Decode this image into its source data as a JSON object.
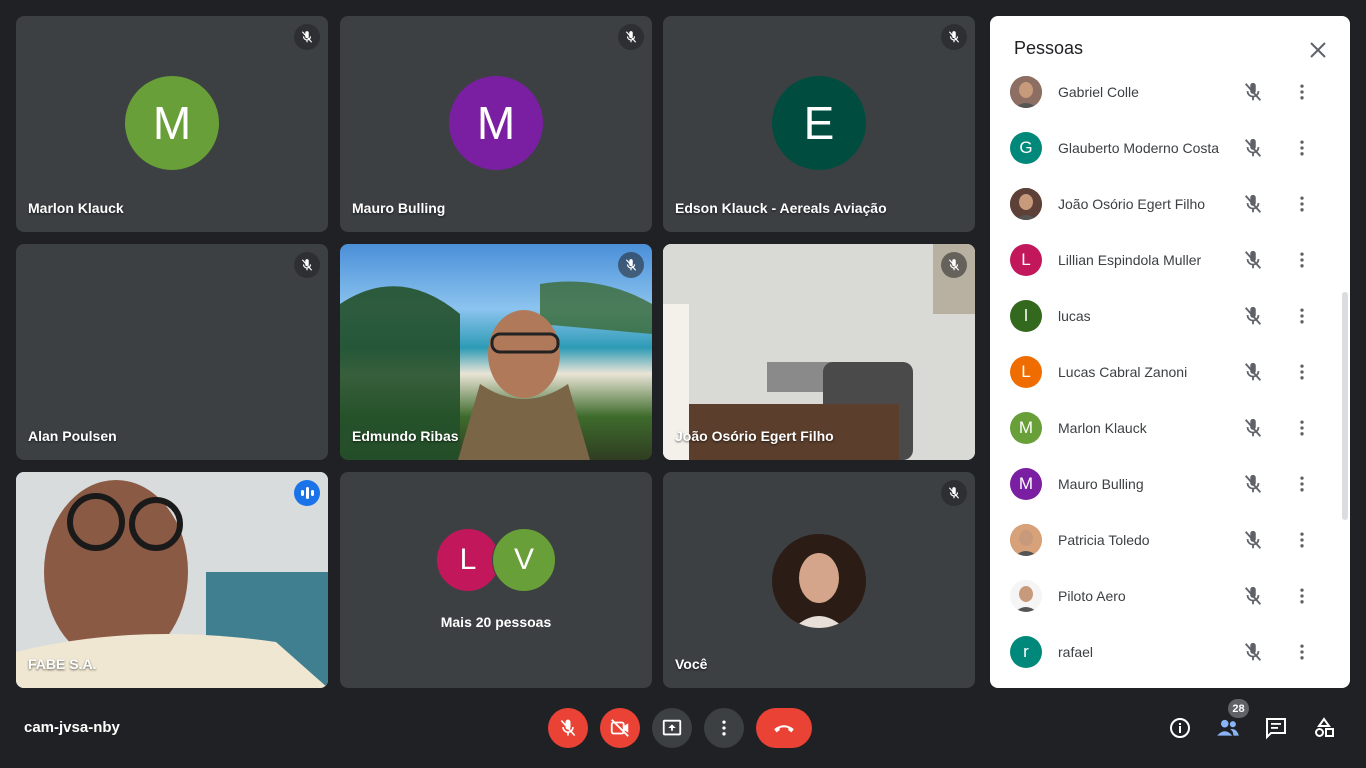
{
  "tiles": [
    {
      "name": "Marlon Klauck",
      "initial": "M",
      "color": "#689f38"
    },
    {
      "name": "Mauro Bulling",
      "initial": "M",
      "color": "#7b1fa2"
    },
    {
      "name": "Edson Klauck - Aereals Aviação",
      "initial": "E",
      "color": "#004d40"
    },
    {
      "name": "Alan Poulsen"
    },
    {
      "name": "Edmundo Ribas"
    },
    {
      "name": "João Osório Egert Filho"
    },
    {
      "name": "FABE S.A."
    },
    {
      "label": "Mais 20 pessoas",
      "avatars": [
        {
          "initial": "L",
          "color": "#c2185b"
        },
        {
          "initial": "V",
          "color": "#689f38"
        }
      ]
    },
    {
      "name": "Você"
    }
  ],
  "panel": {
    "title": "Pessoas",
    "people": [
      {
        "name": "Gabriel Colle",
        "initial": "",
        "color": "#8d6e63",
        "photo": true
      },
      {
        "name": "Glauberto Moderno Costa",
        "initial": "G",
        "color": "#00897b"
      },
      {
        "name": "João Osório Egert Filho",
        "initial": "",
        "color": "#5d4037",
        "photo": true
      },
      {
        "name": "Lillian Espindola Muller",
        "initial": "L",
        "color": "#c2185b"
      },
      {
        "name": "lucas",
        "initial": "l",
        "color": "#33691e"
      },
      {
        "name": "Lucas Cabral Zanoni",
        "initial": "L",
        "color": "#ef6c00"
      },
      {
        "name": "Marlon Klauck",
        "initial": "M",
        "color": "#689f38"
      },
      {
        "name": "Mauro Bulling",
        "initial": "M",
        "color": "#7b1fa2"
      },
      {
        "name": "Patricia Toledo",
        "initial": "",
        "color": "#d7a27a",
        "photo": true
      },
      {
        "name": "Piloto Aero",
        "initial": "",
        "color": "#f5f5f5",
        "photo": true
      },
      {
        "name": "rafael",
        "initial": "r",
        "color": "#00897b"
      }
    ]
  },
  "bottom": {
    "meeting_code": "cam-jvsa-nby",
    "participants_count": "28"
  },
  "icons": {
    "mic_off": "mic-off-icon",
    "camera_off": "camera-off-icon",
    "present": "present-screen-icon",
    "more": "more-options-icon",
    "hangup": "phone-hangup-icon",
    "info": "info-icon",
    "people": "people-icon",
    "chat": "chat-icon",
    "activities": "activities-icon"
  }
}
